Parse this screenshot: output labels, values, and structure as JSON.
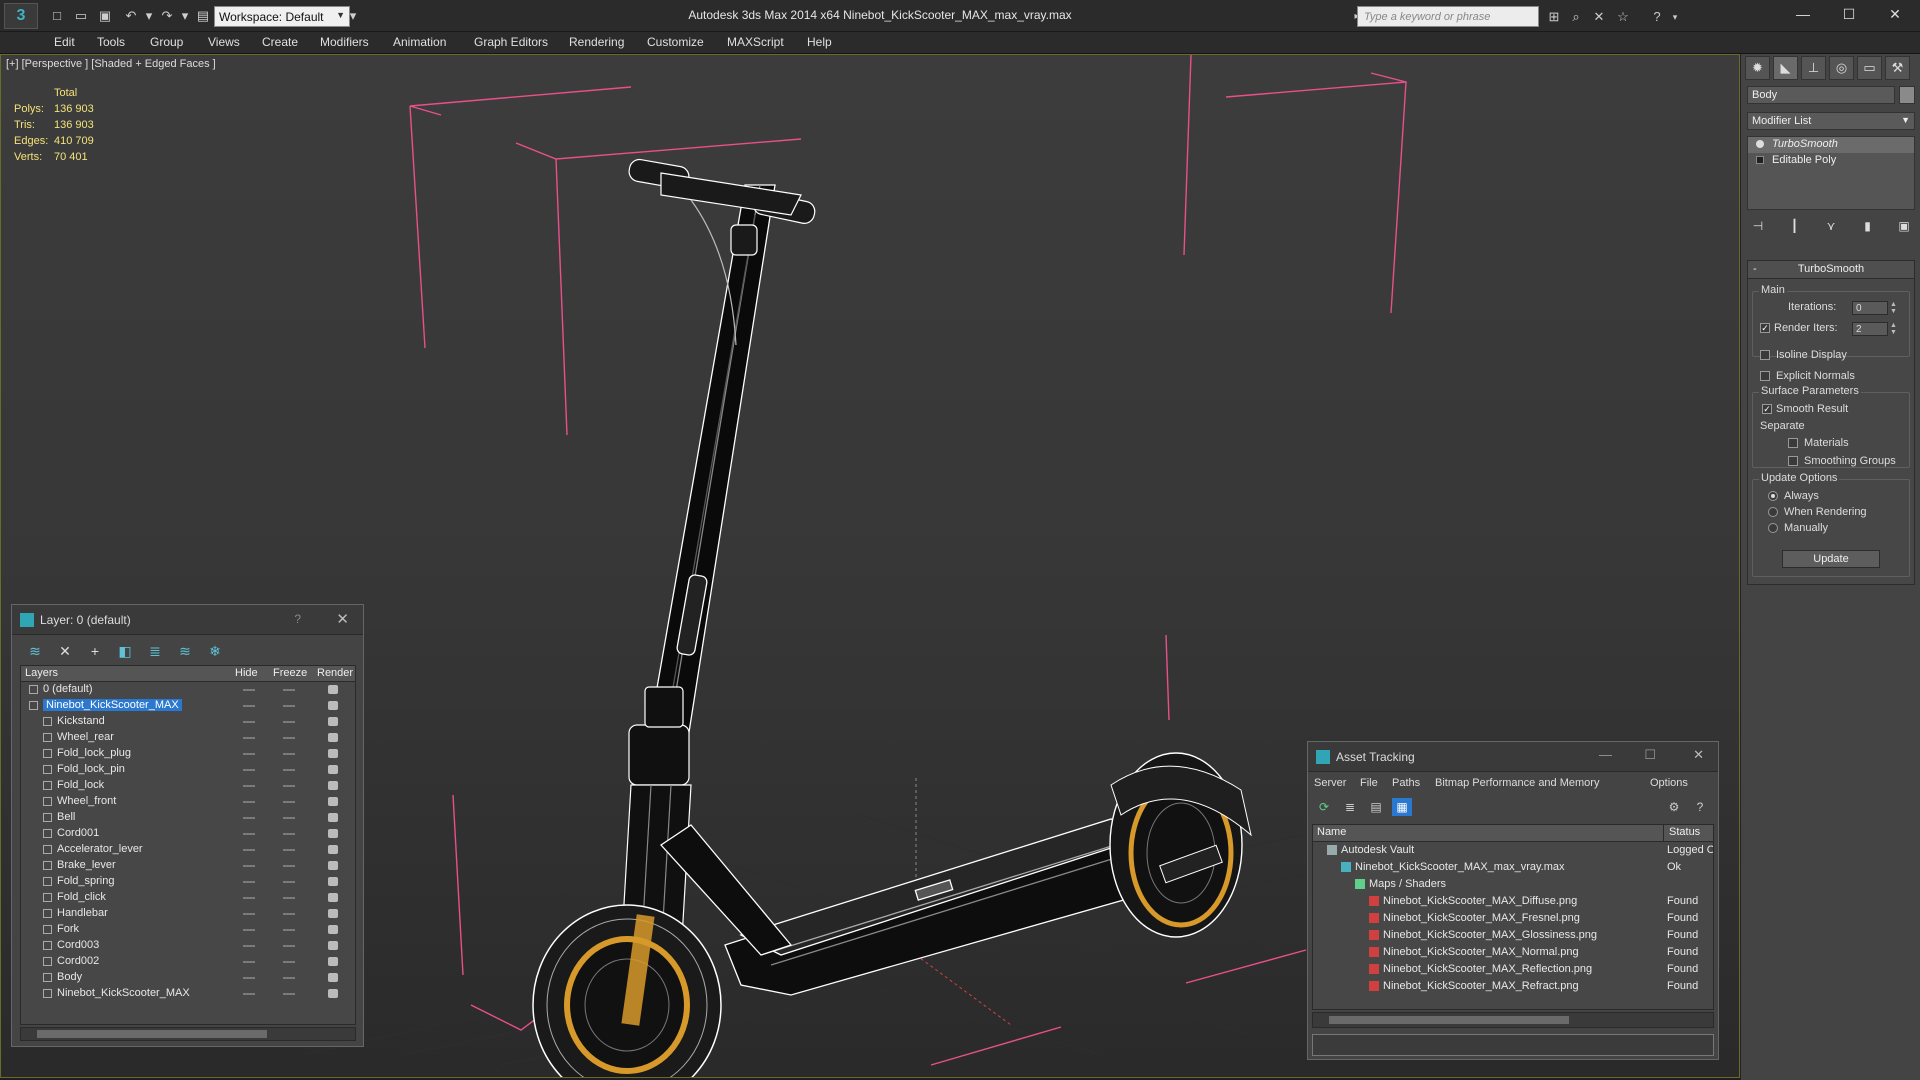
{
  "titlebar": {
    "app_title": "Autodesk 3ds Max  2014 x64      Ninebot_KickScooter_MAX_max_vray.max",
    "workspace": "Workspace: Default",
    "search_placeholder": "Type a keyword or phrase"
  },
  "menu": [
    "Edit",
    "Tools",
    "Group",
    "Views",
    "Create",
    "Modifiers",
    "Animation",
    "Graph Editors",
    "Rendering",
    "Customize",
    "MAXScript",
    "Help"
  ],
  "viewport": {
    "label": "[+] [Perspective ] [Shaded + Edged Faces ]",
    "stats": {
      "header": "Total",
      "rows": [
        {
          "label": "Polys:",
          "value": "136 903"
        },
        {
          "label": "Tris:",
          "value": "136 903"
        },
        {
          "label": "Edges:",
          "value": "410 709"
        },
        {
          "label": "Verts:",
          "value": "70 401"
        }
      ]
    },
    "colors": {
      "bbox": "#e8508a",
      "wire": "#ffffff",
      "tire_accent": "#d79a2a"
    }
  },
  "command_panel": {
    "object_name": "Body",
    "modifier_list": "Modifier List",
    "stack": [
      "TurboSmooth",
      "Editable Poly"
    ],
    "rollout_title": "TurboSmooth",
    "main_group": "Main",
    "iterations_label": "Iterations:",
    "iterations_value": "0",
    "render_iters_label": "Render Iters:",
    "render_iters_value": "2",
    "render_iters_checked": true,
    "isoline_label": "Isoline Display",
    "explicit_normals_label": "Explicit Normals",
    "surface_group": "Surface Parameters",
    "smooth_result_label": "Smooth Result",
    "separate_label": "Separate",
    "materials_label": "Materials",
    "smoothing_groups_label": "Smoothing Groups",
    "update_group": "Update Options",
    "always_label": "Always",
    "when_rendering_label": "When Rendering",
    "manually_label": "Manually",
    "update_button": "Update"
  },
  "layer_dialog": {
    "title": "Layer: 0 (default)",
    "columns": {
      "layers": "Layers",
      "hide": "Hide",
      "freeze": "Freeze",
      "render": "Render"
    },
    "rows": [
      {
        "name": "0 (default)",
        "level": 0
      },
      {
        "name": "Ninebot_KickScooter_MAX",
        "level": 0,
        "selected": true
      },
      {
        "name": "Kickstand",
        "level": 1
      },
      {
        "name": "Wheel_rear",
        "level": 1
      },
      {
        "name": "Fold_lock_plug",
        "level": 1
      },
      {
        "name": "Fold_lock_pin",
        "level": 1
      },
      {
        "name": "Fold_lock",
        "level": 1
      },
      {
        "name": "Wheel_front",
        "level": 1
      },
      {
        "name": "Bell",
        "level": 1
      },
      {
        "name": "Cord001",
        "level": 1
      },
      {
        "name": "Accelerator_lever",
        "level": 1
      },
      {
        "name": "Brake_lever",
        "level": 1
      },
      {
        "name": "Fold_spring",
        "level": 1
      },
      {
        "name": "Fold_click",
        "level": 1
      },
      {
        "name": "Handlebar",
        "level": 1
      },
      {
        "name": "Fork",
        "level": 1
      },
      {
        "name": "Cord003",
        "level": 1
      },
      {
        "name": "Cord002",
        "level": 1
      },
      {
        "name": "Body",
        "level": 1
      },
      {
        "name": "Ninebot_KickScooter_MAX",
        "level": 1
      }
    ]
  },
  "asset_dialog": {
    "title": "Asset Tracking",
    "menu": [
      "Server",
      "File",
      "Paths",
      "Bitmap Performance and Memory",
      "Options"
    ],
    "columns": {
      "name": "Name",
      "status": "Status"
    },
    "rows": [
      {
        "name": "Autodesk Vault",
        "status": "Logged O",
        "level": 0,
        "icon": "vault"
      },
      {
        "name": "Ninebot_KickScooter_MAX_max_vray.max",
        "status": "Ok",
        "level": 1,
        "icon": "max"
      },
      {
        "name": "Maps / Shaders",
        "status": "",
        "level": 2,
        "icon": "maps"
      },
      {
        "name": "Ninebot_KickScooter_MAX_Diffuse.png",
        "status": "Found",
        "level": 3,
        "icon": "png"
      },
      {
        "name": "Ninebot_KickScooter_MAX_Fresnel.png",
        "status": "Found",
        "level": 3,
        "icon": "png"
      },
      {
        "name": "Ninebot_KickScooter_MAX_Glossiness.png",
        "status": "Found",
        "level": 3,
        "icon": "png"
      },
      {
        "name": "Ninebot_KickScooter_MAX_Normal.png",
        "status": "Found",
        "level": 3,
        "icon": "png"
      },
      {
        "name": "Ninebot_KickScooter_MAX_Reflection.png",
        "status": "Found",
        "level": 3,
        "icon": "png"
      },
      {
        "name": "Ninebot_KickScooter_MAX_Refract.png",
        "status": "Found",
        "level": 3,
        "icon": "png"
      }
    ]
  }
}
